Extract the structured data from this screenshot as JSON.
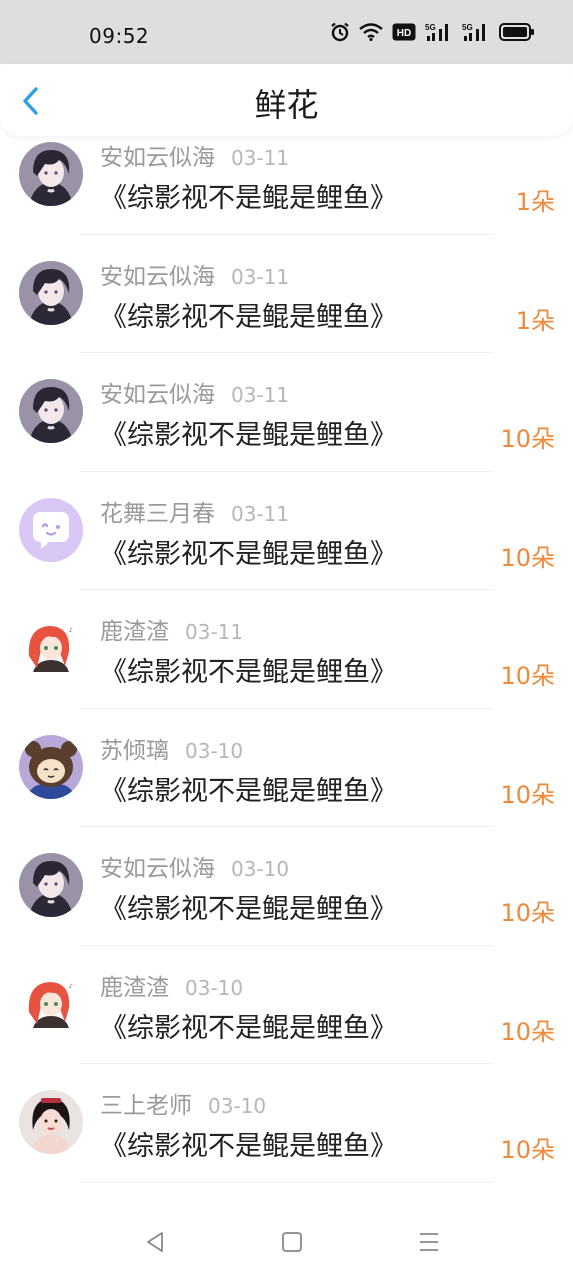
{
  "status": {
    "time": "09:52"
  },
  "header": {
    "title": "鲜花"
  },
  "items": [
    {
      "name": "安如云似海",
      "date": "03-11",
      "book": "《综影视不是鲲是鲤鱼》",
      "amount": "1朵",
      "avatar": "dark-haired-boy"
    },
    {
      "name": "安如云似海",
      "date": "03-11",
      "book": "《综影视不是鲲是鲤鱼》",
      "amount": "1朵",
      "avatar": "dark-haired-boy"
    },
    {
      "name": "安如云似海",
      "date": "03-11",
      "book": "《综影视不是鲲是鲤鱼》",
      "amount": "10朵",
      "avatar": "dark-haired-boy"
    },
    {
      "name": "花舞三月春",
      "date": "03-11",
      "book": "《综影视不是鲲是鲤鱼》",
      "amount": "10朵",
      "avatar": "default-chat"
    },
    {
      "name": "鹿渣渣",
      "date": "03-11",
      "book": "《综影视不是鲲是鲤鱼》",
      "amount": "10朵",
      "avatar": "red-haired-girl"
    },
    {
      "name": "苏倾璃",
      "date": "03-10",
      "book": "《综影视不是鲲是鲤鱼》",
      "amount": "10朵",
      "avatar": "bear-hood"
    },
    {
      "name": "安如云似海",
      "date": "03-10",
      "book": "《综影视不是鲲是鲤鱼》",
      "amount": "10朵",
      "avatar": "dark-haired-boy"
    },
    {
      "name": "鹿渣渣",
      "date": "03-10",
      "book": "《综影视不是鲲是鲤鱼》",
      "amount": "10朵",
      "avatar": "red-haired-girl"
    },
    {
      "name": "三上老师",
      "date": "03-10",
      "book": "《综影视不是鲲是鲤鱼》",
      "amount": "10朵",
      "avatar": "photo-woman"
    }
  ],
  "colors": {
    "accent": "#2e9fe6",
    "amount": "#ef8a3c"
  },
  "nav": {
    "icons": [
      "back-triangle-icon",
      "home-square-icon",
      "menu-lines-icon"
    ]
  }
}
